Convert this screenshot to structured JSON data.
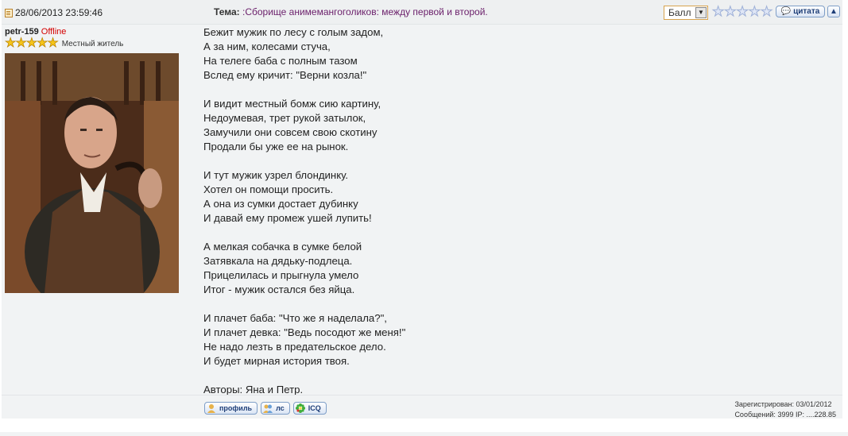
{
  "post": {
    "date": "28/06/2013 23:59:46",
    "topic_label": "Тема:",
    "topic_value": ":Сборище анимемангоголиков: между первой и второй.",
    "rating_select": "Балл",
    "quote_label": "цитата",
    "author": {
      "name": "petr-159",
      "status": "Offline",
      "rank": "Местный житель"
    },
    "message_lines": [
      "Бежит мужик по лесу с голым задом,",
      "А за ним, колесами стуча,",
      "На телеге баба с полным тазом",
      "Вслед ему кричит: \"Верни козла!\"",
      "",
      "И видит местный бомж сию картину,",
      "Недоумевая, трет рукой затылок,",
      "Замучили они совсем свою скотину",
      "Продали бы уже ее на рынок.",
      "",
      "И тут мужик узрел блондинку.",
      "Хотел он помощи просить.",
      "А она из сумки достает дубинку",
      "И давай ему промеж ушей лупить!",
      "",
      "А мелкая собачка в сумке белой",
      "Затявкала на дядьку-подлеца.",
      "Прицелилась и прыгнула умело",
      "Итог - мужик остался без яйца.",
      "",
      "И плачет баба: \"Что же я наделала?\",",
      "И плачет девка: \"Ведь посодют же меня!\"",
      "Не надо лезть в предательское дело.",
      "И будет мирная история твоя.",
      "",
      "Авторы: Яна и Петр."
    ],
    "footer": {
      "profile_label": "профиль",
      "pm_label": "лс",
      "icq_label": "ICQ",
      "registered": "Зарегистрирован: 03/01/2012",
      "messages": "Сообщений: 3999 IP: ....228.85"
    }
  },
  "colors": {
    "offline": "#d40000",
    "topic": "#6a1e6a",
    "stars": "#f5c419"
  }
}
